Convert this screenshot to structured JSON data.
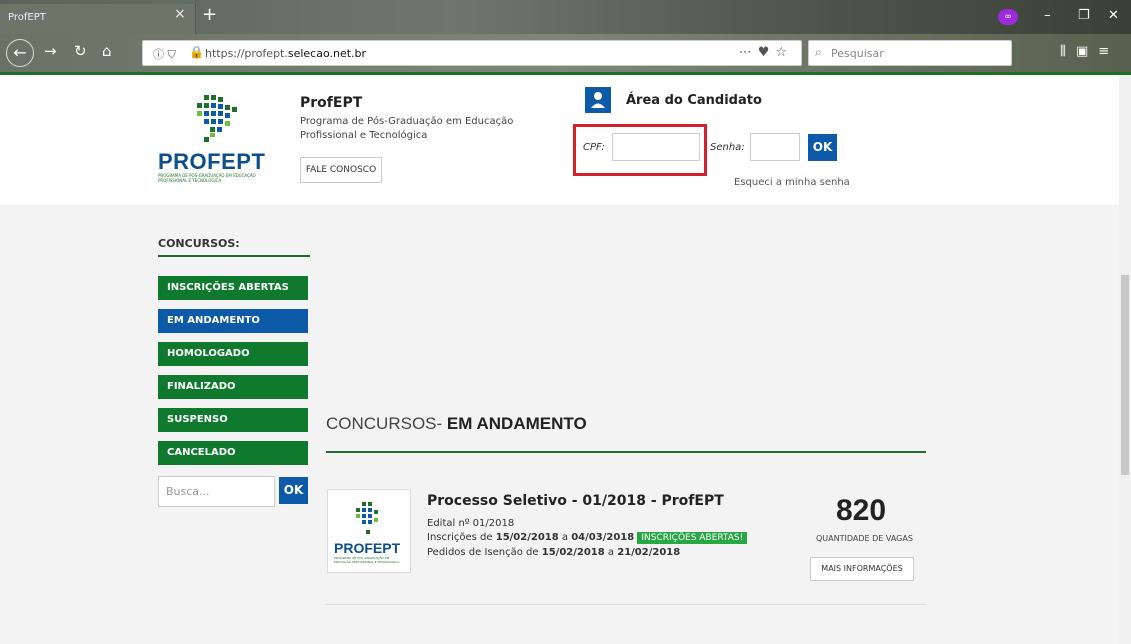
{
  "browser": {
    "tab_title": "ProfEPT",
    "url_prefix": "https://profept.",
    "url_domain": "selecao.net.br",
    "search_placeholder": "Pesquisar"
  },
  "header": {
    "logo_text": "PROFEPT",
    "logo_sub": "PROGRAMA DE PÓS-GRADUAÇÃO EM EDUCAÇÃO PROFISSIONAL E TECNOLÓGICA",
    "site_title": "ProfEPT",
    "site_sub": "Programa de Pós-Graduação em Educação Profissional e Tecnológica",
    "contact_label": "FALE CONOSCO"
  },
  "login": {
    "title": "Área do Candidato",
    "cpf_label": "CPF:",
    "senha_label": "Senha:",
    "ok_label": "OK",
    "forgot_label": "Esqueci a minha senha"
  },
  "sidebar": {
    "title": "CONCURSOS:",
    "items": [
      {
        "label": "INSCRIÇÕES ABERTAS",
        "color": "#0f7a2e"
      },
      {
        "label": "EM ANDAMENTO",
        "color": "#0d5aa8"
      },
      {
        "label": "HOMOLOGADO",
        "color": "#0f7a2e"
      },
      {
        "label": "FINALIZADO",
        "color": "#0f7a2e"
      },
      {
        "label": "SUSPENSO",
        "color": "#0f7a2e"
      },
      {
        "label": "CANCELADO",
        "color": "#0f7a2e"
      }
    ],
    "search_placeholder": "Busca...",
    "search_ok": "OK"
  },
  "main": {
    "heading_prefix": "CONCURSOS-",
    "heading_bold": "EM ANDAMENTO",
    "card": {
      "title": "Processo Seletivo - 01/2018 - ProfEPT",
      "edital": "Edital nº 01/2018",
      "inscricoes_prefix": "Inscrições de",
      "inscricoes_start": "15/02/2018",
      "inscricoes_mid": "a",
      "inscricoes_end": "04/03/2018",
      "badge": "INSCRIÇÕES ABERTAS!",
      "isencao_prefix": "Pedidos de Isenção de",
      "isencao_start": "15/02/2018",
      "isencao_mid": "a",
      "isencao_end": "21/02/2018",
      "vagas": "820",
      "vagas_label": "QUANTIDADE DE VAGAS",
      "more_label": "MAIS INFORMAÇÕES"
    }
  }
}
